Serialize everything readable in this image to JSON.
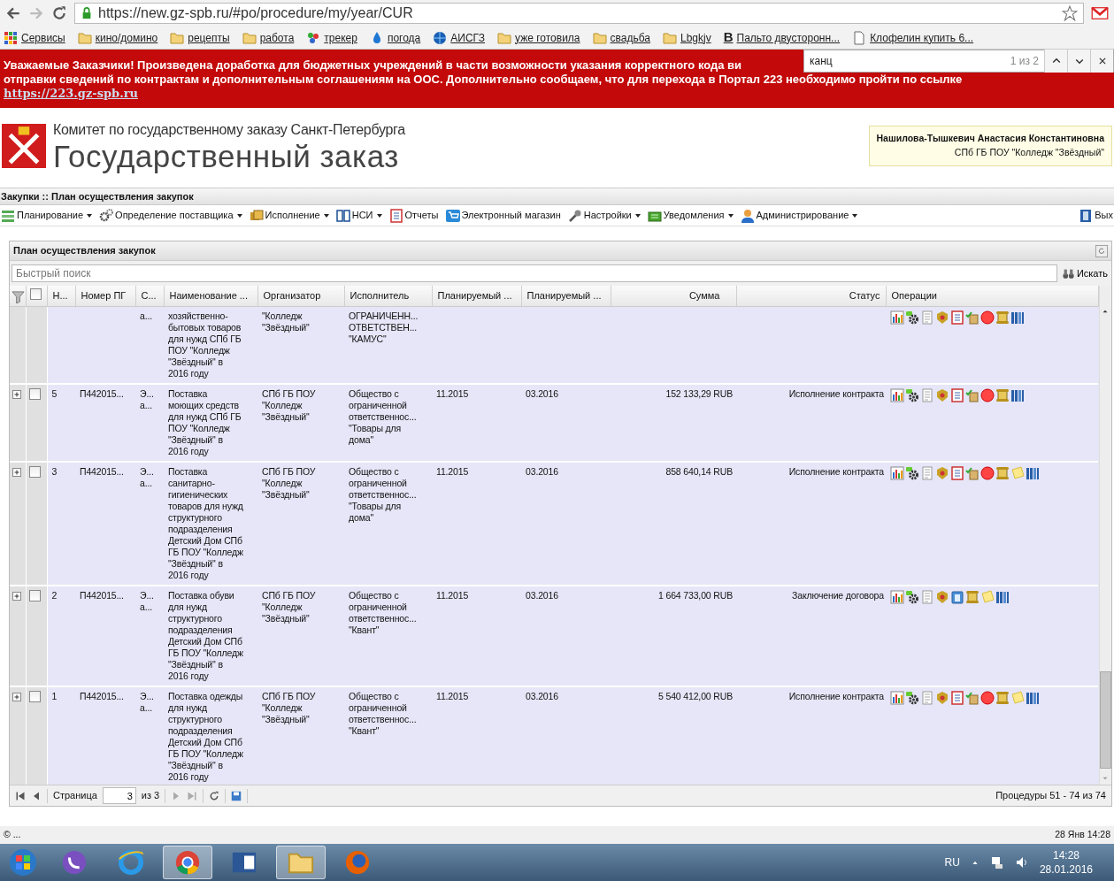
{
  "browser": {
    "url": "https://new.gz-spb.ru/#po/procedure/my/year/CUR"
  },
  "bookmarks": [
    {
      "label": "Сервисы",
      "kind": "apps"
    },
    {
      "label": "кино/домино",
      "kind": "folder"
    },
    {
      "label": "рецепты",
      "kind": "folder"
    },
    {
      "label": "работа",
      "kind": "folder"
    },
    {
      "label": "трекер",
      "kind": "tracker"
    },
    {
      "label": "погода",
      "kind": "weather"
    },
    {
      "label": "АИСГЗ",
      "kind": "globe"
    },
    {
      "label": "уже готовила",
      "kind": "folder"
    },
    {
      "label": "свадьба",
      "kind": "folder"
    },
    {
      "label": "Lbgkjv",
      "kind": "folder"
    },
    {
      "label": "Пальто двусторонн...",
      "kind": "letter",
      "favicon": "B"
    },
    {
      "label": "Клофелин купить 6...",
      "kind": "page"
    }
  ],
  "find_bar": {
    "query": "канц",
    "count": "1 из 2"
  },
  "banner": {
    "lines": [
      "Уважаемые Заказчики! Произведена доработка для бюджетных учреждений в части возможности указания корректного кода ви",
      "отправки сведений по контрактам и дополнительным соглашениям на ООС. Дополнительно сообщаем, что для перехода в Портал 223 необходимо пройти по ссылке"
    ],
    "link": "https://223.gz-spb.ru"
  },
  "header": {
    "subtitle": "Комитет по государственному заказу Санкт-Петербурга",
    "title": "Государственный заказ",
    "user": {
      "name": "Нашилова-Тышкевич Анастасия Константиновна",
      "org": "СПб ГБ ПОУ \"Колледж \"Звёздный\""
    }
  },
  "breadcrumb": "Закупки :: План осуществления закупок",
  "menu": [
    {
      "label": "Планирование",
      "kind": "plan",
      "dropdown": true
    },
    {
      "label": "Определение поставщика",
      "kind": "gears",
      "dropdown": true
    },
    {
      "label": "Исполнение",
      "kind": "folders",
      "dropdown": true
    },
    {
      "label": "НСИ",
      "kind": "book",
      "dropdown": true
    },
    {
      "label": "Отчеты",
      "kind": "notebook",
      "dropdown": false
    },
    {
      "label": "Электронный магазин",
      "kind": "cart",
      "dropdown": false
    },
    {
      "label": "Настройки",
      "kind": "wrench",
      "dropdown": true
    },
    {
      "label": "Уведомления",
      "kind": "box",
      "dropdown": true
    },
    {
      "label": "Администрирование",
      "kind": "person",
      "dropdown": true
    }
  ],
  "menu_right": {
    "label": "Вых",
    "kind": "exit"
  },
  "panel": {
    "title": "План осуществления закупок",
    "search": {
      "placeholder": "Быстрый поиск",
      "button": "Искать"
    },
    "table": {
      "columns": [
        "Н...",
        "Номер ПГ",
        "С...",
        "Наименование ...",
        "Организатор",
        "Исполнитель",
        "Планируемый ...",
        "Планируемый ...",
        "Сумма",
        "Статус",
        "Операции"
      ],
      "select_all": {
        "checked": false
      },
      "rows": [
        {
          "column_3": "а...",
          "name": "хозяйственно-\nбытовых товаров\nдля нужд СПб ГБ\nПОУ \"Колледж\n\"Звёздный\" в\n2016 году",
          "organizer": "\"Колледж\n\"Звёздный\"",
          "executor": "ОГРАНИЧЕНН...\nОТВЕТСТВЕН...\n\"КАМУС\"",
          "operations": [
            {
              "kind": "chart"
            },
            {
              "kind": "gear"
            },
            {
              "kind": "document"
            },
            {
              "kind": "emblem"
            },
            {
              "kind": "notebook"
            },
            {
              "kind": "checklist"
            },
            {
              "kind": "stop"
            },
            {
              "kind": "scroll"
            },
            {
              "kind": "binders"
            }
          ]
        },
        {
          "expanded": false,
          "checked": false,
          "number": "5",
          "plan_number": "П442015...",
          "column_3": "Э...\nа...",
          "name": "Поставка\nмоющих средств\nдля нужд СПб ГБ\nПОУ \"Колледж\n\"Звёздный\" в\n2016 году",
          "organizer": "СПб ГБ ПОУ\n\"Колледж\n\"Звёздный\"",
          "executor": "Общество с\nограниченной\nответственнос...\n\"Товары для\nдома\"",
          "planned_1": "11.2015",
          "planned_2": "03.2016",
          "sum": "152 133,29 RUB",
          "status": "Исполнение контракта",
          "operations": [
            {
              "kind": "chart"
            },
            {
              "kind": "gear"
            },
            {
              "kind": "document"
            },
            {
              "kind": "emblem"
            },
            {
              "kind": "notebook"
            },
            {
              "kind": "checklist"
            },
            {
              "kind": "stop"
            },
            {
              "kind": "scroll"
            },
            {
              "kind": "binders"
            }
          ]
        },
        {
          "expanded": false,
          "checked": false,
          "number": "3",
          "plan_number": "П442015...",
          "column_3": "Э...\nа...",
          "name": "Поставка\nсанитарно-\nгигиенических\nтоваров для нужд\nструктурного\nподразделения\nДетский Дом СПб\nГБ ПОУ \"Колледж\n\"Звёздный\" в\n2016 году",
          "organizer": "СПб ГБ ПОУ\n\"Колледж\n\"Звёздный\"",
          "executor": "Общество с\nограниченной\nответственнос...\n\"Товары для\nдома\"",
          "planned_1": "11.2015",
          "planned_2": "03.2016",
          "sum": "858 640,14 RUB",
          "status": "Исполнение контракта",
          "operations": [
            {
              "kind": "chart"
            },
            {
              "kind": "gear"
            },
            {
              "kind": "document"
            },
            {
              "kind": "emblem"
            },
            {
              "kind": "notebook"
            },
            {
              "kind": "checklist"
            },
            {
              "kind": "stop"
            },
            {
              "kind": "scroll"
            },
            {
              "kind": "note"
            },
            {
              "kind": "binders"
            }
          ]
        },
        {
          "expanded": false,
          "checked": false,
          "number": "2",
          "plan_number": "П442015...",
          "column_3": "Э...\nа...",
          "name": "Поставка обуви\nдля нужд\nструктурного\nподразделения\nДетский Дом СПб\nГБ ПОУ \"Колледж\n\"Звёздный\" в\n2016 году",
          "organizer": "СПб ГБ ПОУ\n\"Колледж\n\"Звёздный\"",
          "executor": "Общество с\nограниченной\nответственнос...\n\"Квант\"",
          "planned_1": "11.2015",
          "planned_2": "03.2016",
          "sum": "1 664 733,00 RUB",
          "status": "Заключение договора",
          "operations": [
            {
              "kind": "chart"
            },
            {
              "kind": "gear"
            },
            {
              "kind": "document"
            },
            {
              "kind": "emblem"
            },
            {
              "kind": "clipboard"
            },
            {
              "kind": "scroll"
            },
            {
              "kind": "note"
            },
            {
              "kind": "binders"
            }
          ]
        },
        {
          "expanded": false,
          "checked": false,
          "number": "1",
          "plan_number": "П442015...",
          "column_3": "Э...\nа...",
          "name": "Поставка одежды\nдля нужд\nструктурного\nподразделения\nДетский Дом СПб\nГБ ПОУ \"Колледж\n\"Звёздный\" в\n2016 году",
          "organizer": "СПб ГБ ПОУ\n\"Колледж\n\"Звёздный\"",
          "executor": "Общество с\nограниченной\nответственнос...\n\"Квант\"",
          "planned_1": "11.2015",
          "planned_2": "03.2016",
          "sum": "5 540 412,00 RUB",
          "status": "Исполнение контракта",
          "operations": [
            {
              "kind": "chart"
            },
            {
              "kind": "gear"
            },
            {
              "kind": "document"
            },
            {
              "kind": "emblem"
            },
            {
              "kind": "notebook"
            },
            {
              "kind": "checklist"
            },
            {
              "kind": "stop"
            },
            {
              "kind": "scroll"
            },
            {
              "kind": "note"
            },
            {
              "kind": "binders"
            }
          ]
        }
      ]
    },
    "pager": {
      "page_label": "Страница",
      "page": "3",
      "of": "из 3",
      "summary": "Процедуры 51 - 74 из 74"
    }
  },
  "footer": {
    "left": "© ...",
    "right": "28 Янв 14:28"
  },
  "taskbar": {
    "apps": [
      {
        "kind": "viber",
        "active": false
      },
      {
        "kind": "ie",
        "active": false
      },
      {
        "kind": "chrome",
        "active": true
      },
      {
        "kind": "word",
        "active": false
      },
      {
        "kind": "explorer",
        "active": true
      },
      {
        "kind": "firefox",
        "active": false
      }
    ],
    "language": "RU",
    "time": "14:28",
    "date": "28.01.2016"
  }
}
